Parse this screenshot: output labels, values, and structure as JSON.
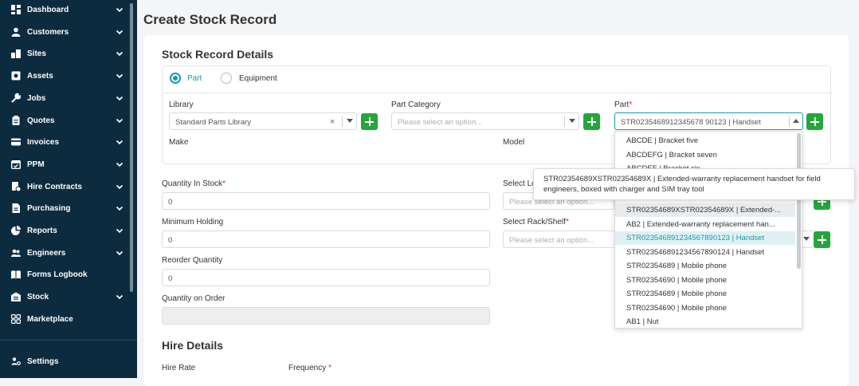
{
  "sidebar": {
    "items": [
      {
        "label": "Dashboard",
        "icon": "dashboard-icon",
        "chevron": true
      },
      {
        "label": "Customers",
        "icon": "user-icon",
        "chevron": true
      },
      {
        "label": "Sites",
        "icon": "building-icon",
        "chevron": true
      },
      {
        "label": "Assets",
        "icon": "asset-icon",
        "chevron": true
      },
      {
        "label": "Jobs",
        "icon": "wrench-icon",
        "chevron": true
      },
      {
        "label": "Quotes",
        "icon": "clipboard-icon",
        "chevron": true
      },
      {
        "label": "Invoices",
        "icon": "invoice-icon",
        "chevron": true
      },
      {
        "label": "PPM",
        "icon": "calendar-icon",
        "chevron": true
      },
      {
        "label": "Hire Contracts",
        "icon": "hire-icon",
        "chevron": true
      },
      {
        "label": "Purchasing",
        "icon": "document-icon",
        "chevron": true
      },
      {
        "label": "Reports",
        "icon": "pie-chart-icon",
        "chevron": true
      },
      {
        "label": "Engineers",
        "icon": "users-icon",
        "chevron": true
      },
      {
        "label": "Forms Logbook",
        "icon": "book-icon",
        "chevron": false
      },
      {
        "label": "Stock",
        "icon": "warehouse-icon",
        "chevron": true
      },
      {
        "label": "Marketplace",
        "icon": "grid-icon",
        "chevron": false
      }
    ],
    "settings_label": "Settings",
    "settings_icon": "settings-icon"
  },
  "page": {
    "title": "Create Stock Record",
    "section_stock": "Stock Record Details",
    "section_hire": "Hire Details"
  },
  "type_radio": {
    "part_label": "Part",
    "equipment_label": "Equipment",
    "selected": "Part"
  },
  "form": {
    "library_label": "Library",
    "library_value": "Standard Parts Library",
    "part_category_label": "Part Category",
    "part_category_placeholder": "Please select an option...",
    "part_label": "Part",
    "part_required": "*",
    "part_value": "STR0235468912345678 90123 | Handset",
    "make_label": "Make",
    "model_label": "Model",
    "quantity_label": "Quantity In Stock",
    "quantity_required": "*",
    "quantity_value": "0",
    "location_label": "Select Lo",
    "location_placeholder": "Please select an option...",
    "min_holding_label": "Minimum Holding",
    "min_holding_value": "0",
    "rack_label": "Select Rack/Shelf",
    "rack_required": "*",
    "rack_placeholder": "Please select an option...",
    "reorder_label": "Reorder Quantity",
    "reorder_value": "0",
    "on_order_label": "Quantity on Order",
    "on_order_value": "",
    "hire_rate_label": "Hire Rate",
    "frequency_label": "Frequency",
    "frequency_required": "*"
  },
  "part_dropdown": {
    "options": [
      "ABCDE | Bracket five",
      "ABCDEFG | Bracket seven",
      "ABCDEF | Bracket six",
      "STR02354689XSTR02354689X | Extended-warranty replacement handset for field engineers, boxed with charger and SIM tray tool",
      "STR02354689XSTR02354689X | Extended-...",
      "AB2 | Extended-warranty replacement han...",
      "STR023546891234567890123 | Handset",
      "STR023546891234567890124 | Handset",
      "STR02354689 | Mobile phone",
      "STR02354690 | Mobile phone",
      "STR02354689 | Mobile phone",
      "STR02354690 | Mobile phone",
      "AB1 | Nut"
    ],
    "hovered_index": 4,
    "selected_index": 6
  },
  "tooltip": {
    "text": "STR02354689XSTR02354689X | Extended-warranty replacement handset for field engineers, boxed with charger and SIM tray tool"
  },
  "colors": {
    "sidebar_bg": "#0d2b3e",
    "accent": "#1a9ba8",
    "add_button": "#25a63c",
    "required": "#d9262c"
  }
}
